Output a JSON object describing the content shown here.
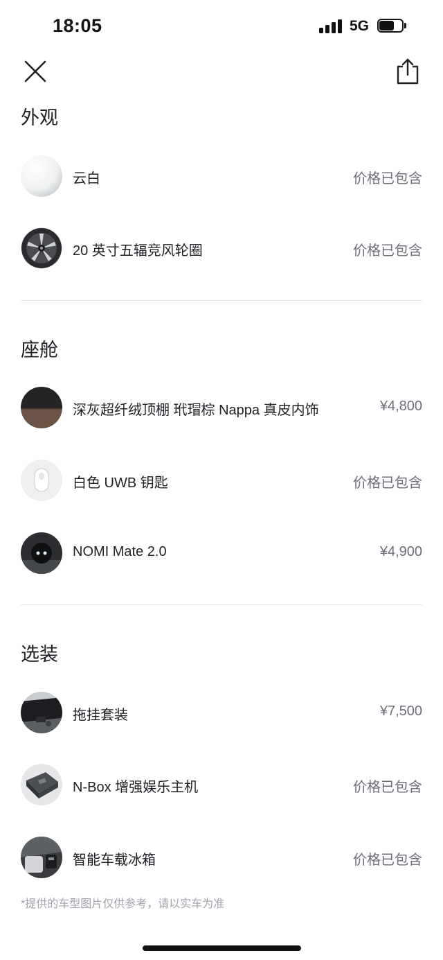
{
  "status_bar": {
    "time": "18:05",
    "network": "5G"
  },
  "header": {
    "close_icon": "close-icon",
    "share_icon": "share-icon"
  },
  "sections": [
    {
      "title": "外观",
      "items": [
        {
          "label": "云白",
          "price": "价格已包含",
          "thumb": "white-paint-swatch"
        },
        {
          "label": "20 英寸五辐竞风轮圈",
          "price": "价格已包含",
          "thumb": "wheel-rim"
        }
      ]
    },
    {
      "title": "座舱",
      "items": [
        {
          "label": "深灰超纤绒顶棚 玳瑁棕 Nappa 真皮内饰",
          "price": "¥4,800",
          "thumb": "interior-swatch"
        },
        {
          "label": "白色 UWB 钥匙",
          "price": "价格已包含",
          "thumb": "uwb-key"
        },
        {
          "label": "NOMI Mate 2.0",
          "price": "¥4,900",
          "thumb": "nomi-mate"
        }
      ]
    },
    {
      "title": "选装",
      "items": [
        {
          "label": "拖挂套装",
          "price": "¥7,500",
          "thumb": "tow-hitch"
        },
        {
          "label": "N-Box 增强娱乐主机",
          "price": "价格已包含",
          "thumb": "n-box"
        },
        {
          "label": "智能车载冰箱",
          "price": "价格已包含",
          "thumb": "car-fridge"
        }
      ]
    }
  ],
  "footnote": "*提供的车型图片仅供参考，请以实车为准"
}
